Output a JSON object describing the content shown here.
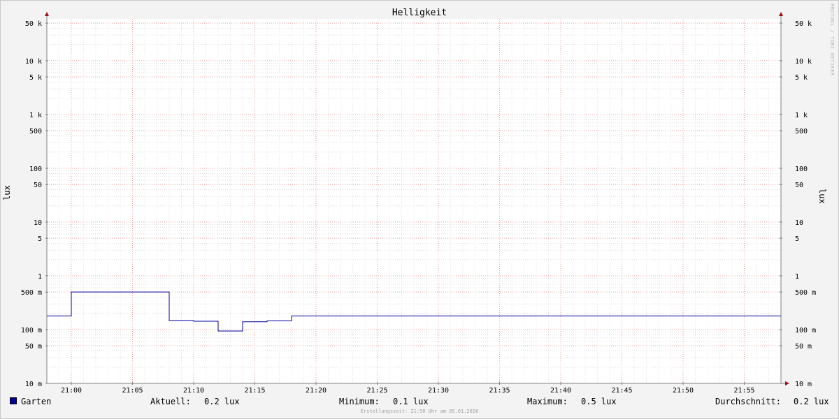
{
  "chart_data": {
    "type": "line",
    "title": "Helligkeit",
    "ylabel": "lux",
    "y_scale": "log",
    "ylim": [
      0.01,
      60000
    ],
    "x_range": [
      "20:58",
      "21:58"
    ],
    "x_tick_labels": [
      "21:00",
      "21:05",
      "21:10",
      "21:15",
      "21:20",
      "21:25",
      "21:30",
      "21:35",
      "21:40",
      "21:45",
      "21:50",
      "21:55"
    ],
    "y_ticks": [
      {
        "value": 50000,
        "label": "50 k"
      },
      {
        "value": 10000,
        "label": "10 k"
      },
      {
        "value": 5000,
        "label": "5 k"
      },
      {
        "value": 1000,
        "label": "1 k"
      },
      {
        "value": 500,
        "label": "500"
      },
      {
        "value": 100,
        "label": "100"
      },
      {
        "value": 50,
        "label": "50"
      },
      {
        "value": 10,
        "label": "10"
      },
      {
        "value": 5,
        "label": "5"
      },
      {
        "value": 1,
        "label": "1"
      },
      {
        "value": 0.5,
        "label": "500 m"
      },
      {
        "value": 0.1,
        "label": "100 m"
      },
      {
        "value": 0.05,
        "label": "50 m"
      },
      {
        "value": 0.01,
        "label": "10 m"
      }
    ],
    "grid": true,
    "series": [
      {
        "name": "Garten",
        "color": "#0000a0",
        "points": [
          {
            "x": "20:58",
            "y": 0.18
          },
          {
            "x": "21:00",
            "y": 0.18
          },
          {
            "x": "21:00",
            "y": 0.5
          },
          {
            "x": "21:08",
            "y": 0.5
          },
          {
            "x": "21:08",
            "y": 0.148
          },
          {
            "x": "21:10",
            "y": 0.148
          },
          {
            "x": "21:10",
            "y": 0.143
          },
          {
            "x": "21:12",
            "y": 0.143
          },
          {
            "x": "21:12",
            "y": 0.094
          },
          {
            "x": "21:14",
            "y": 0.094
          },
          {
            "x": "21:14",
            "y": 0.14
          },
          {
            "x": "21:16",
            "y": 0.14
          },
          {
            "x": "21:16",
            "y": 0.145
          },
          {
            "x": "21:18",
            "y": 0.145
          },
          {
            "x": "21:18",
            "y": 0.18
          },
          {
            "x": "21:58",
            "y": 0.18
          }
        ]
      }
    ]
  },
  "legend": {
    "series_name": "Garten",
    "current_label": "Aktuell:",
    "current_value": "0.2 lux",
    "min_label": "Minimum:",
    "min_value": "0.1 lux",
    "max_label": "Maximum:",
    "max_value": "0.5 lux",
    "avg_label": "Durchschnitt:",
    "avg_value": "0.2 lux"
  },
  "footer": "Erstellungszeit: 21:58 Uhr am 05.01.2026",
  "watermark": "RRDTOOL / TOBI OETIKER"
}
